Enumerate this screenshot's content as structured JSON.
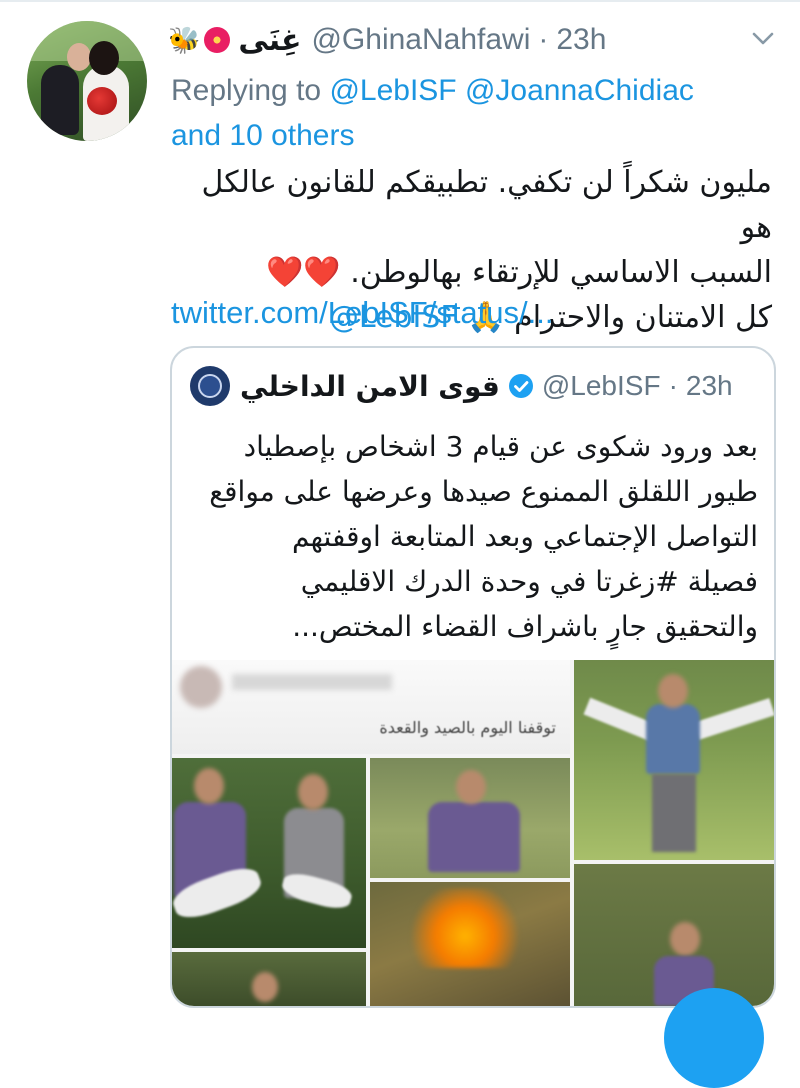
{
  "tweet": {
    "display_name": "غِنَى",
    "emoji_icons": [
      "bee-icon",
      "flower-icon"
    ],
    "handle": "@GhinaNahfawi",
    "separator": "·",
    "time": "23h",
    "reply_prefix": "Replying to",
    "reply_mentions": "@LebISF @JoannaChidiac",
    "reply_suffix": "and 10 others",
    "text_line1": "مليون شكراً لن تكفي. تطبيقكم للقانون عالكل هو",
    "text_line2": "السبب الاساسي للإرتقاء بهالوطن. ❤️❤️",
    "text_line3_prefix": "كل الامتنان والاحترام 🙏",
    "text_line3_mention": "@LebISF",
    "link": "twitter.com/LebISF/status/..."
  },
  "quoted_tweet": {
    "display_name": "قوى الامن الداخلي",
    "verified": true,
    "handle": "@LebISF",
    "separator": "·",
    "time": "23h",
    "text_lines": [
      "بعد ورود شكوى عن قيام 3 اشخاص بإصطياد",
      "طيور اللقلق الممنوع صيدها وعرضها على مواقع",
      "التواصل الإجتماعي وبعد المتابعة اوقفتهم",
      "فصيلة #زغرتا في وحدة الدرك الاقليمي",
      "والتحقيق جارٍ باشراف القضاء المختص..."
    ],
    "image_caption": "توقفنا اليوم بالصيد والقعدة"
  },
  "colors": {
    "link": "#1b95e0",
    "secondary_text": "#657786",
    "border": "#ccd6dd",
    "fab": "#1da1f2"
  }
}
